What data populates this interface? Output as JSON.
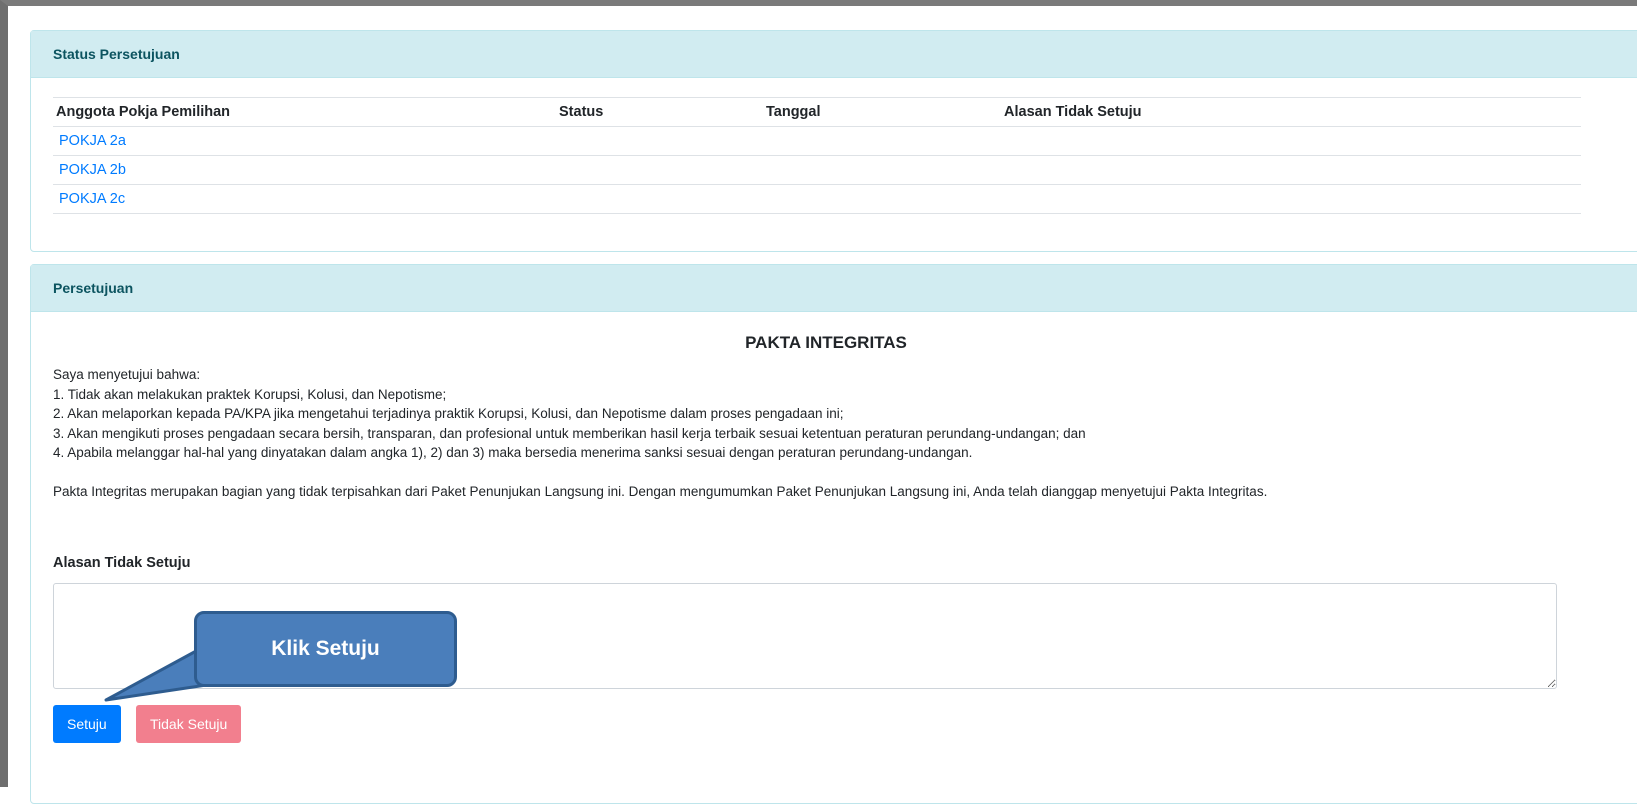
{
  "status_card": {
    "header": "Status Persetujuan",
    "columns": [
      "Anggota Pokja Pemilihan",
      "Status",
      "Tanggal",
      "Alasan Tidak Setuju"
    ],
    "rows": [
      {
        "member": "POKJA 2a",
        "status": "",
        "date": "",
        "reason": ""
      },
      {
        "member": "POKJA 2b",
        "status": "",
        "date": "",
        "reason": ""
      },
      {
        "member": "POKJA 2c",
        "status": "",
        "date": "",
        "reason": ""
      }
    ]
  },
  "approval_card": {
    "header": "Persetujuan",
    "title": "PAKTA INTEGRITAS",
    "intro": "Saya menyetujui bahwa:",
    "points": [
      "1. Tidak akan melakukan praktek Korupsi, Kolusi, dan Nepotisme;",
      "2. Akan melaporkan kepada PA/KPA jika mengetahui terjadinya praktik Korupsi, Kolusi, dan Nepotisme dalam proses pengadaan ini;",
      "3. Akan mengikuti proses pengadaan secara bersih, transparan, dan profesional untuk memberikan hasil kerja terbaik sesuai ketentuan peraturan perundang-undangan; dan",
      "4. Apabila melanggar hal-hal yang dinyatakan dalam angka 1), 2) dan 3) maka bersedia menerima sanksi sesuai dengan peraturan perundang-undangan."
    ],
    "note": "Pakta Integritas merupakan bagian yang tidak terpisahkan dari Paket Penunjukan Langsung ini. Dengan mengumumkan Paket Penunjukan Langsung ini, Anda telah dianggap menyetujui Pakta Integritas.",
    "reason_label": "Alasan Tidak Setuju",
    "reason_value": "",
    "agree_button": "Setuju",
    "disagree_button": "Tidak Setuju"
  },
  "callout": {
    "text": "Klik  Setuju"
  },
  "colors": {
    "header_bg": "#d1ecf1",
    "header_text": "#0c5460",
    "link": "#007bff",
    "primary_button": "#007bff",
    "danger_button": "#f27f8e",
    "callout_fill": "#4a7ebb"
  }
}
